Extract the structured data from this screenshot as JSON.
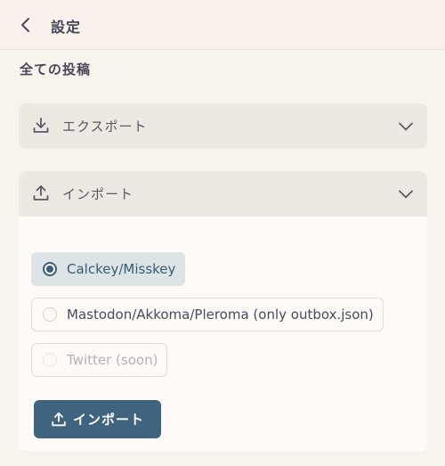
{
  "header": {
    "title": "設定"
  },
  "section": {
    "title": "全ての投稿"
  },
  "export_fold": {
    "label": "エクスポート",
    "expanded": false
  },
  "import_fold": {
    "label": "インポート",
    "expanded": true,
    "options": [
      {
        "label": "Calckey/Misskey",
        "selected": true,
        "disabled": false
      },
      {
        "label": "Mastodon/Akkoma/Pleroma (only outbox.json)",
        "selected": false,
        "disabled": false
      },
      {
        "label": "Twitter (soon)",
        "selected": false,
        "disabled": true
      }
    ],
    "button_label": "インポート"
  },
  "colors": {
    "background": "#f9f3ee",
    "fold_header": "#ece8e2",
    "accent": "#3f6480",
    "selected_option_bg": "#dde4e6"
  }
}
